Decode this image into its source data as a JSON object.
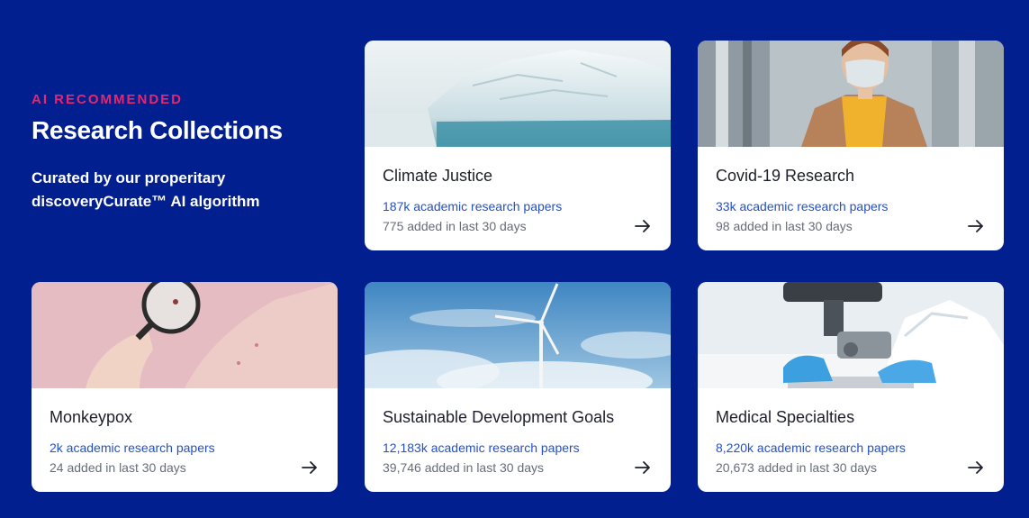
{
  "intro": {
    "eyebrow": "AI RECOMMENDED",
    "title": "Research Collections",
    "subtitle": "Curated by our properitary discoveryCurate™ AI algorithm"
  },
  "collections": [
    {
      "name": "Climate Justice",
      "papers": "187k academic research papers",
      "added": "775 added in last 30 days",
      "image": "iceberg-image"
    },
    {
      "name": "Covid-19 Research",
      "papers": "33k academic research papers",
      "added": "98 added in last 30 days",
      "image": "masked-woman-image"
    },
    {
      "name": "Monkeypox",
      "papers": "2k academic research papers",
      "added": "24 added in last 30 days",
      "image": "magnifying-glass-skin-image"
    },
    {
      "name": "Sustainable Development Goals",
      "papers": "12,183k academic research papers",
      "added": "39,746 added in last 30 days",
      "image": "wind-turbine-image"
    },
    {
      "name": "Medical Specialties",
      "papers": "8,220k academic research papers",
      "added": "20,673 added in last 30 days",
      "image": "microscope-image"
    }
  ],
  "colors": {
    "background": "#021f8f",
    "eyebrow": "#e6266e",
    "link": "#2350c4",
    "muted": "#666c7a",
    "card_title": "#1d1f2b"
  },
  "icons": {
    "card_arrow": "arrow-right-icon"
  }
}
